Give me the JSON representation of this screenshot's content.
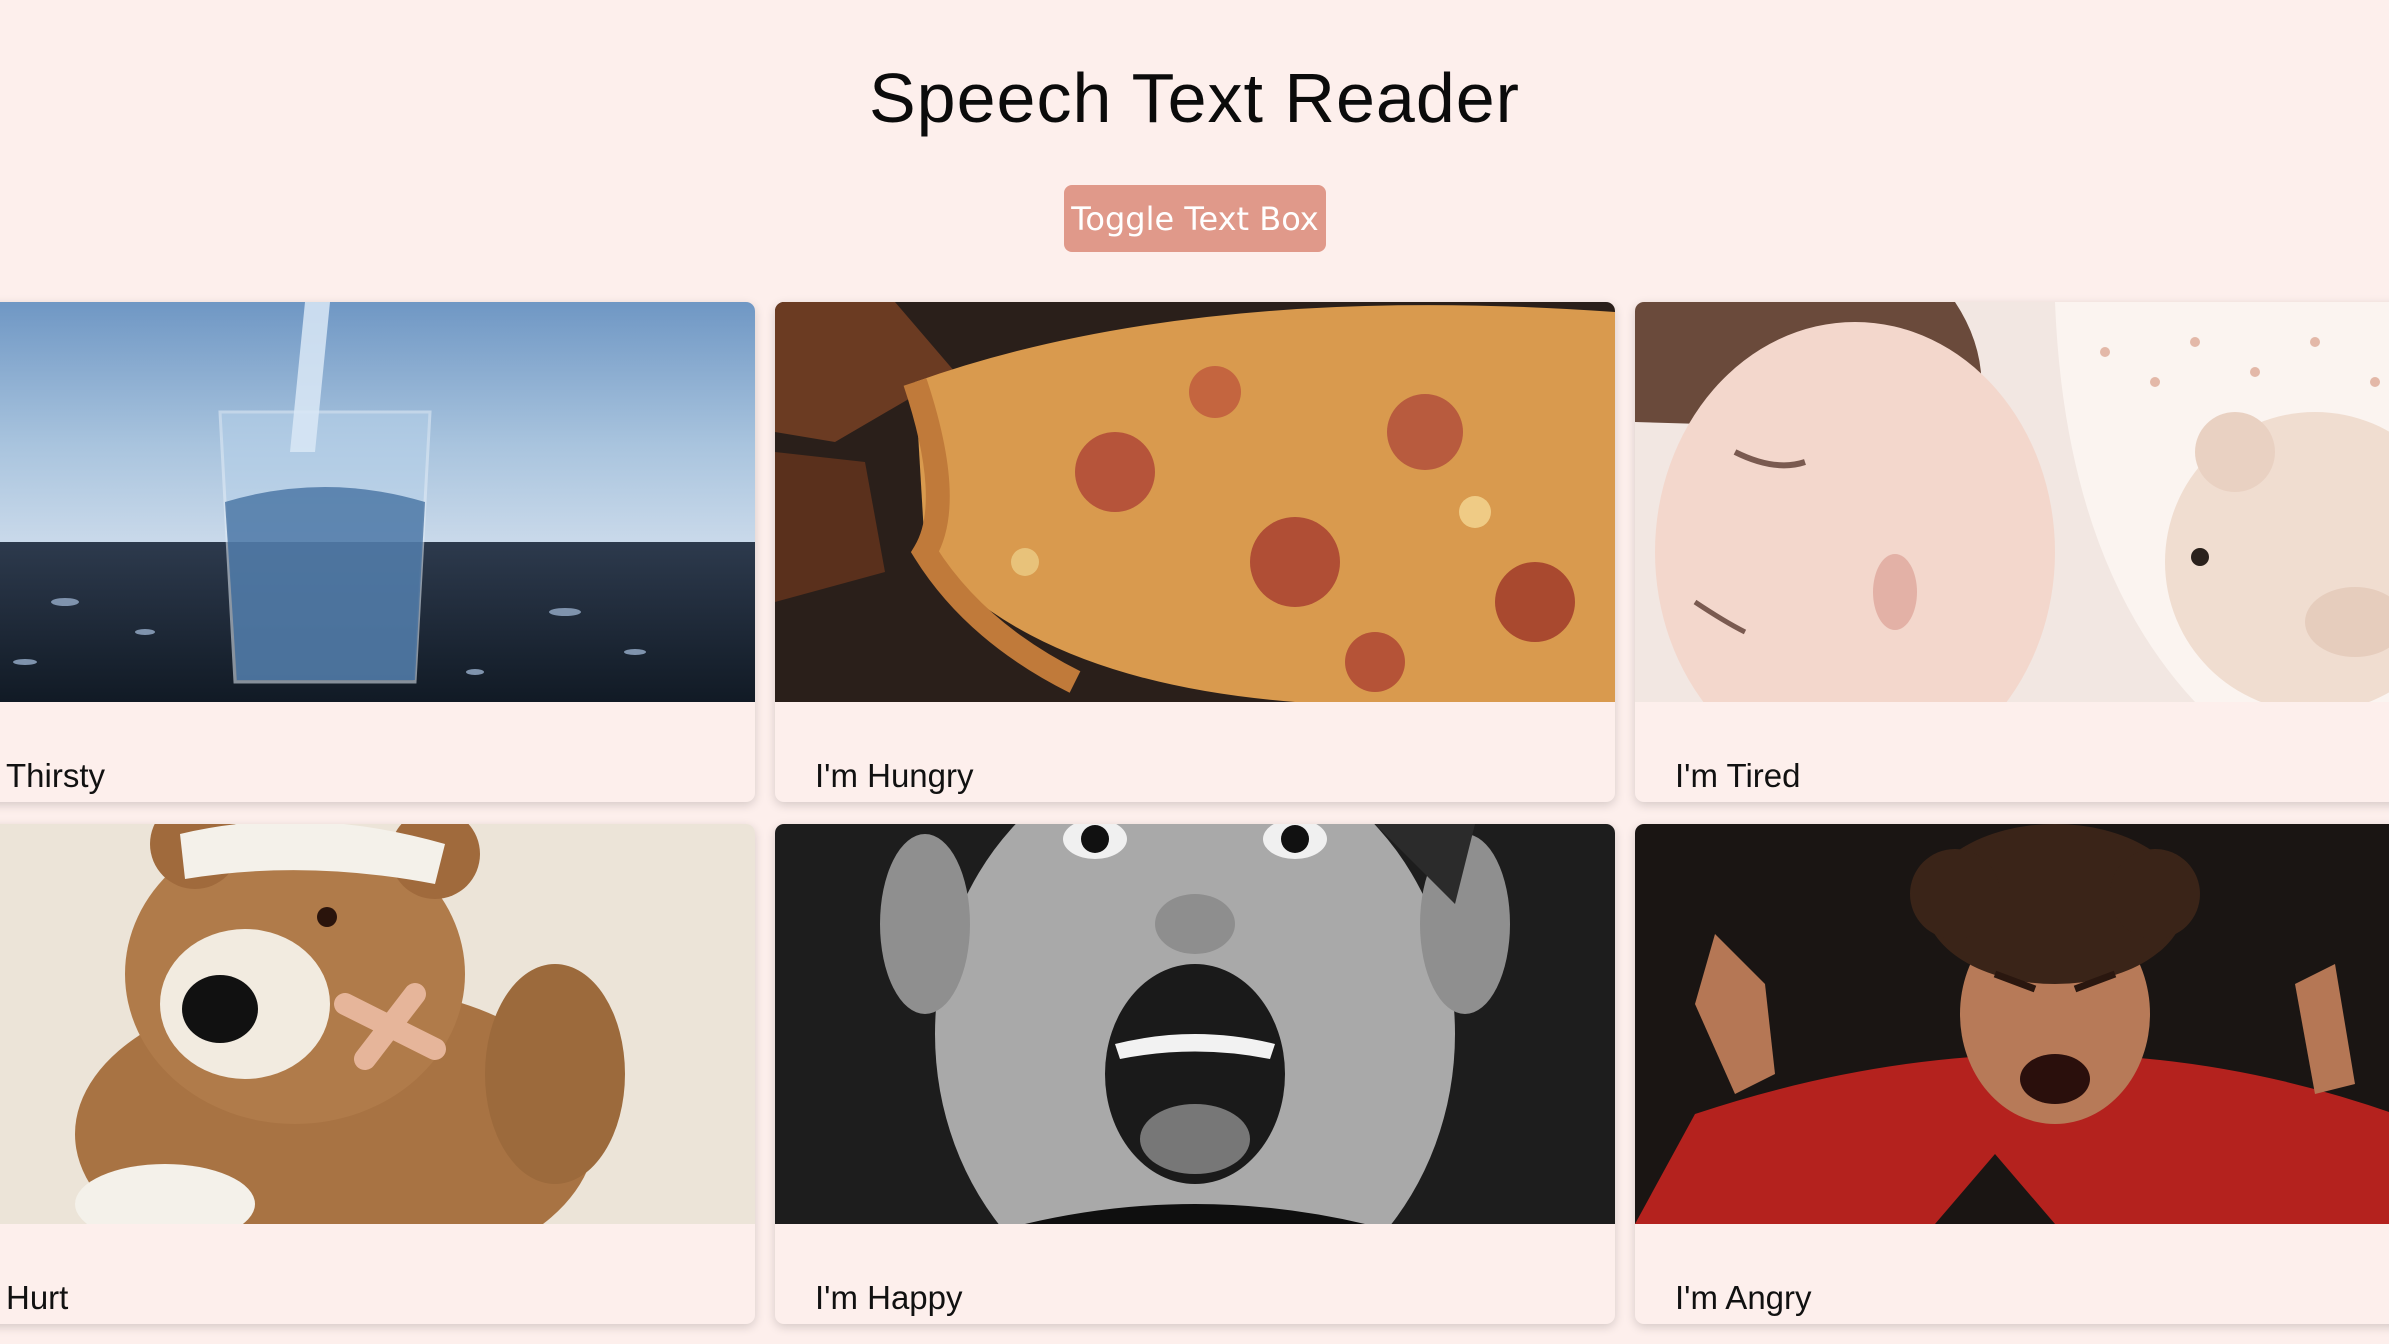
{
  "header": {
    "title": "Speech Text Reader",
    "toggle_label": "Toggle Text Box"
  },
  "cards": [
    {
      "label": "Thirsty",
      "image": "glass-of-water"
    },
    {
      "label": "I'm Hungry",
      "image": "pizza-slice"
    },
    {
      "label": "I'm Tired",
      "image": "sleeping-child"
    },
    {
      "label": "Hurt",
      "image": "bandaged-teddy-bear"
    },
    {
      "label": "I'm Happy",
      "image": "excited-boy"
    },
    {
      "label": "I'm Angry",
      "image": "angry-child"
    }
  ],
  "colors": {
    "background": "#fdefec",
    "button": "#e0998a",
    "text": "#111111"
  }
}
